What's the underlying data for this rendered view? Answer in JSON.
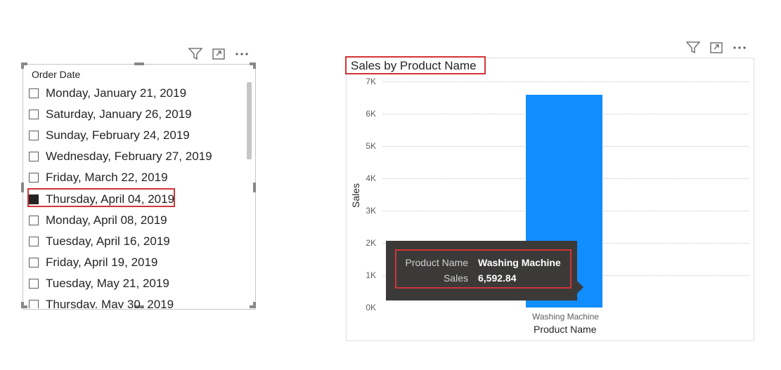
{
  "slicer": {
    "title": "Order Date",
    "items": [
      {
        "label": "Monday, January 21, 2019",
        "checked": false
      },
      {
        "label": "Saturday, January 26, 2019",
        "checked": false
      },
      {
        "label": "Sunday, February 24, 2019",
        "checked": false
      },
      {
        "label": "Wednesday, February 27, 2019",
        "checked": false
      },
      {
        "label": "Friday, March 22, 2019",
        "checked": false
      },
      {
        "label": "Thursday, April 04, 2019",
        "checked": true
      },
      {
        "label": "Monday, April 08, 2019",
        "checked": false
      },
      {
        "label": "Tuesday, April 16, 2019",
        "checked": false
      },
      {
        "label": "Friday, April 19, 2019",
        "checked": false
      },
      {
        "label": "Tuesday, May 21, 2019",
        "checked": false
      },
      {
        "label": "Thursday, May 30, 2019",
        "checked": false
      }
    ]
  },
  "chart": {
    "title": "Sales by Product Name"
  },
  "chart_data": {
    "type": "bar",
    "title": "Sales by Product Name",
    "xlabel": "Product Name",
    "ylabel": "Sales",
    "categories": [
      "Washing Machine"
    ],
    "values": [
      6592.84
    ],
    "ylim": [
      0,
      7000
    ],
    "yticks": [
      "0K",
      "1K",
      "2K",
      "3K",
      "4K",
      "5K",
      "6K",
      "7K"
    ],
    "grid": true,
    "color": "#118dff"
  },
  "tooltip": {
    "rows": [
      {
        "label": "Product Name",
        "value": "Washing Machine"
      },
      {
        "label": "Sales",
        "value": "6,592.84"
      }
    ]
  },
  "icons": [
    "filter-icon",
    "focus-mode-icon",
    "more-options-icon"
  ]
}
